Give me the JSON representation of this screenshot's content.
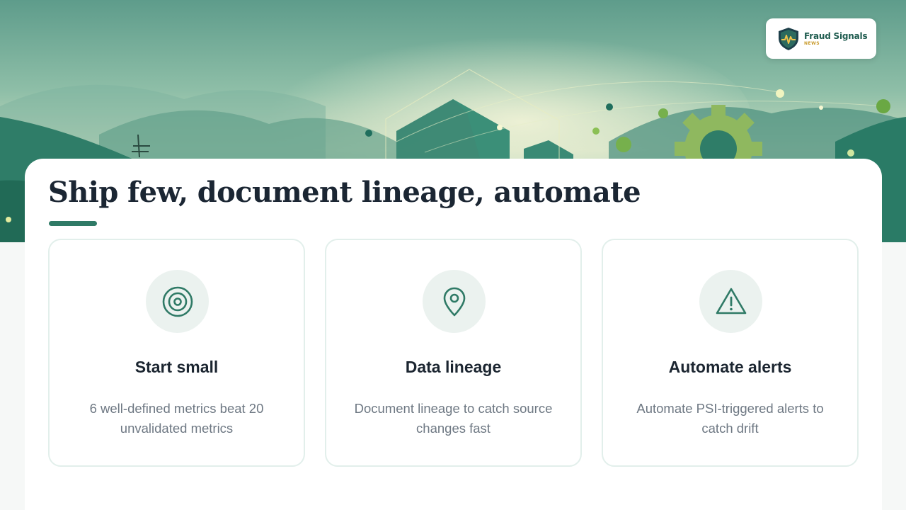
{
  "brand": {
    "name": "Fraud Signals",
    "sub": "NEWS"
  },
  "title": "Ship few, document lineage, automate",
  "cards": [
    {
      "icon": "target-icon",
      "title": "Start small",
      "description": "6 well-defined metrics beat 20 unvalidated metrics"
    },
    {
      "icon": "map-pin-icon",
      "title": "Data lineage",
      "description": "Document lineage to catch source changes fast"
    },
    {
      "icon": "alert-triangle-icon",
      "title": "Automate alerts",
      "description": "Automate PSI-triggered alerts to catch drift"
    }
  ],
  "colors": {
    "accent": "#2f7a66",
    "icon_bg": "#ebf2ef",
    "card_border": "#e2efeb",
    "title_text": "#1b2633",
    "body_text": "#6e7883"
  }
}
